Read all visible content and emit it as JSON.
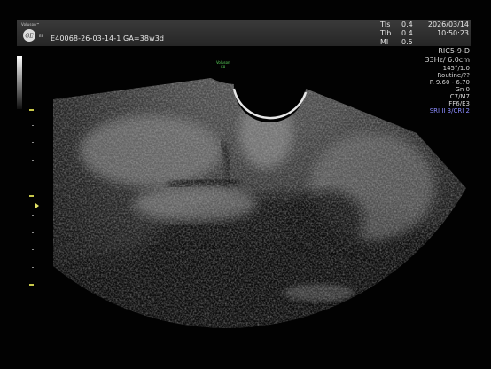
{
  "header": {
    "brand": "Voluson™",
    "mode": "E8",
    "patient_id": "E40068-26-03-14-1  GA=38w3d",
    "indices": [
      {
        "key": "TIs",
        "value": "0.4"
      },
      {
        "key": "TIb",
        "value": "0.4"
      },
      {
        "key": "MI",
        "value": "0.5"
      }
    ],
    "date": "2026/03/14",
    "time": "10:50:23"
  },
  "info": {
    "probe": "RIC5-9-D",
    "frequency_depth": "33Hz/ 6.0cm",
    "angle": "145°/1.0",
    "preset": "Routine/??",
    "range": "R 9.60 - 6.70",
    "gain": "Gn  0",
    "cm": "C7/M7",
    "ff": "FF6/E3",
    "sri": "SRI II 3/CRI 2"
  },
  "badge": {
    "line1": "Voluson",
    "line2": "E8"
  },
  "colors": {
    "sri": "#8c8cff",
    "badge": "#5bd45b",
    "marker": "#e4e466"
  }
}
